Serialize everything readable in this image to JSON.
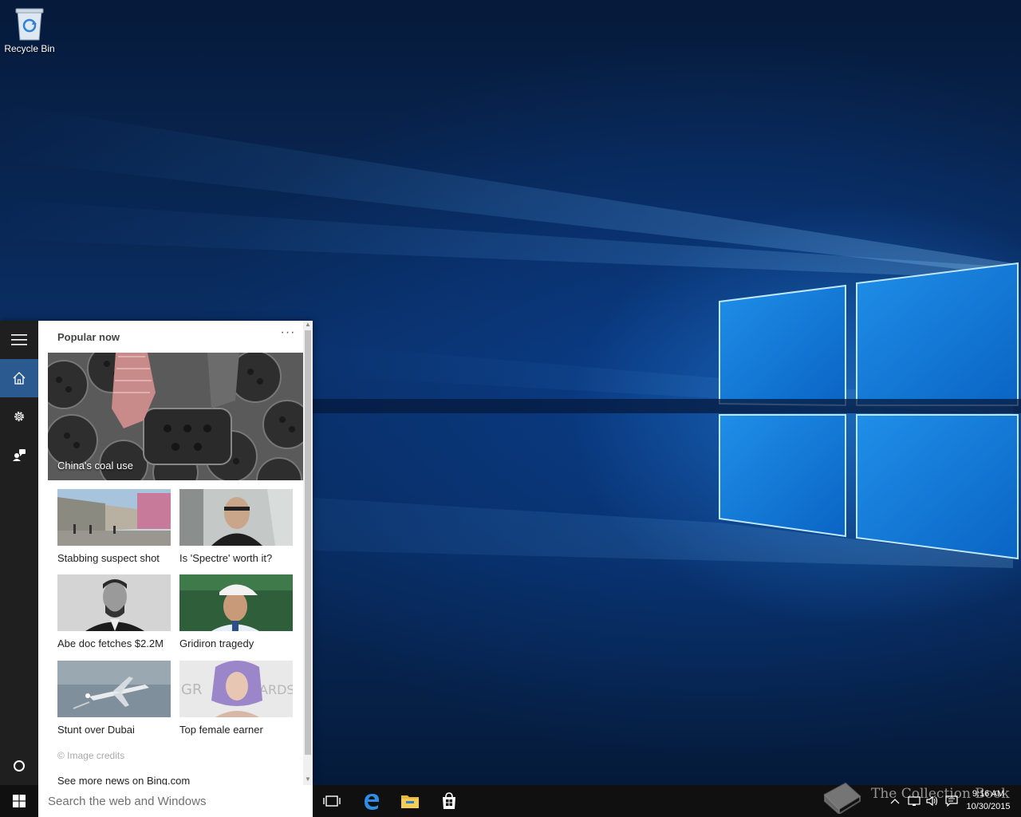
{
  "desktop": {
    "icons": [
      {
        "label": "Recycle Bin",
        "icon": "recycle-bin-icon"
      }
    ]
  },
  "cortana": {
    "rail": {
      "menu_icon": "hamburger-icon",
      "home_icon": "home-icon",
      "settings_icon": "gear-icon",
      "feedback_icon": "feedback-icon",
      "cortana_icon": "cortana-circle-icon"
    },
    "feed": {
      "title": "Popular now",
      "more_label": "···",
      "hero": {
        "caption": "China's coal use"
      },
      "tiles": [
        {
          "caption": "Stabbing suspect shot"
        },
        {
          "caption": "Is 'Spectre' worth it?"
        },
        {
          "caption": "Abe doc fetches $2.2M"
        },
        {
          "caption": "Gridiron tragedy"
        },
        {
          "caption": "Stunt over Dubai"
        },
        {
          "caption": "Top female earner"
        }
      ],
      "credits": "© Image credits",
      "see_more": "See more news on Bing.com"
    }
  },
  "taskbar": {
    "start_icon": "windows-logo-icon",
    "search": {
      "placeholder": "Search the web and Windows",
      "value": ""
    },
    "pinned": [
      {
        "name": "task-view",
        "icon": "task-view-icon"
      },
      {
        "name": "edge",
        "icon": "edge-icon"
      },
      {
        "name": "file-explorer",
        "icon": "folder-icon"
      },
      {
        "name": "store",
        "icon": "store-icon"
      }
    ],
    "tray": {
      "icons": [
        "chevron-up-icon",
        "network-icon",
        "volume-icon",
        "action-center-icon"
      ],
      "time": "9:16 AM",
      "date": "10/30/2015"
    }
  },
  "watermark": {
    "text": "The Collection Book"
  },
  "colors": {
    "taskbar_bg": "#101010",
    "rail_bg": "#1f1f1f",
    "rail_active": "#2a5a8f",
    "accent_blue": "#0078d7"
  }
}
